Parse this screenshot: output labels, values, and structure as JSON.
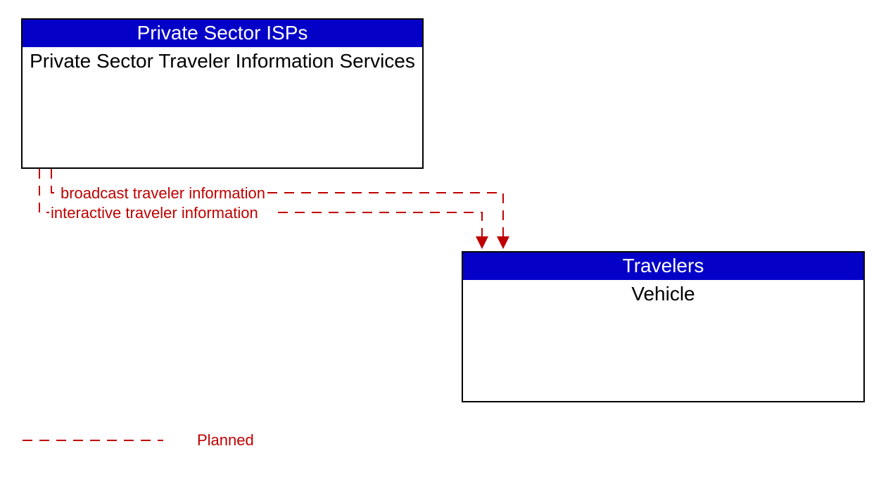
{
  "boxes": {
    "isp": {
      "header": "Private Sector ISPs",
      "body": "Private Sector Traveler Information Services"
    },
    "travelers": {
      "header": "Travelers",
      "body": "Vehicle"
    }
  },
  "flows": {
    "flow1": "broadcast traveler information",
    "flow2": "interactive traveler information"
  },
  "legend": {
    "planned": "Planned"
  },
  "colors": {
    "header_bg": "#0500c8",
    "flow": "#c00000",
    "border": "#000000"
  }
}
